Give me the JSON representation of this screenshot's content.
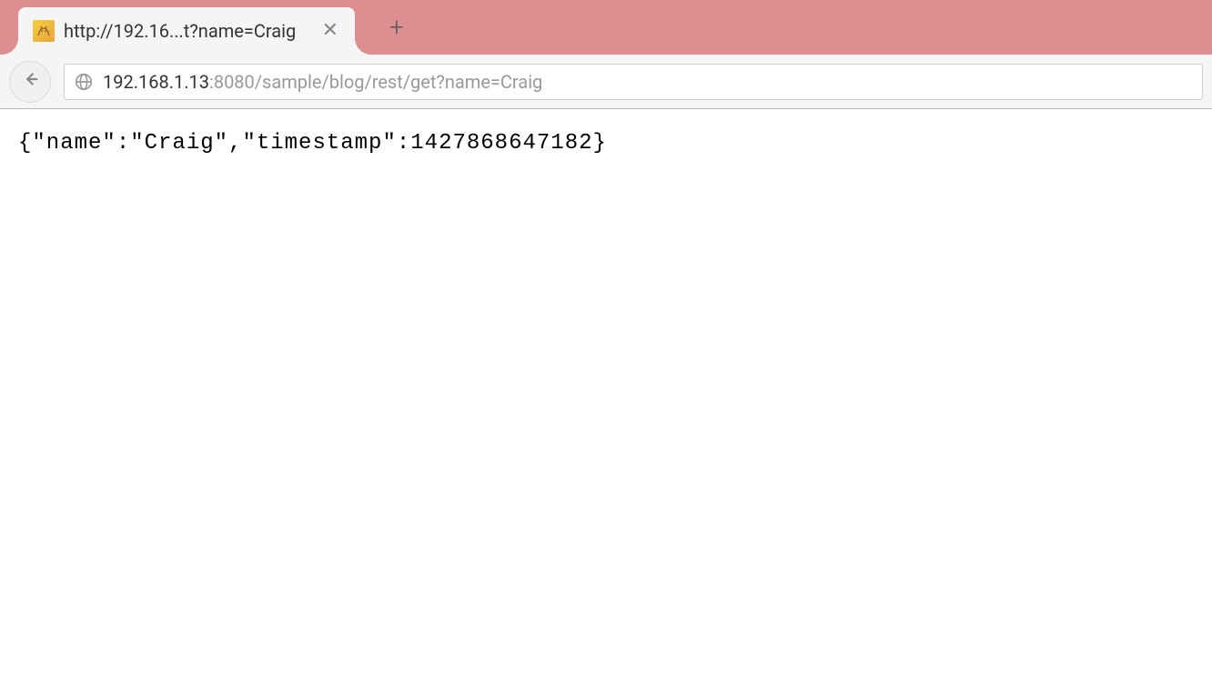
{
  "tab": {
    "title": "http://192.16...t?name=Craig",
    "favicon_glyph": "🐈"
  },
  "toolbar": {
    "url_host": "192.168.1.13",
    "url_path": ":8080/sample/blog/rest/get?name=Craig"
  },
  "content": {
    "body_text": "{\"name\":\"Craig\",\"timestamp\":1427868647182}"
  }
}
